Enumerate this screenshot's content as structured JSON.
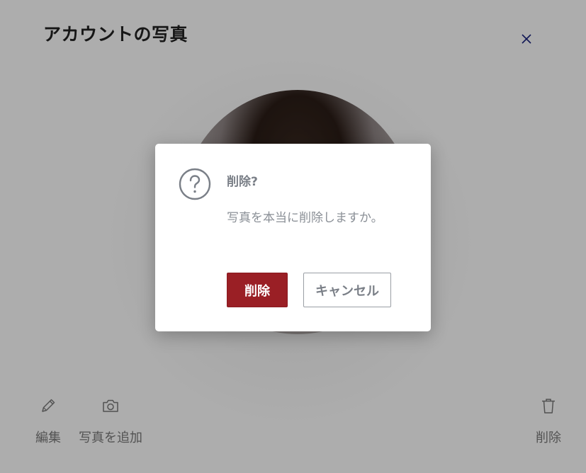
{
  "panel": {
    "title": "アカウントの写真",
    "close_icon": "close-icon",
    "actions": {
      "edit": {
        "label": "編集",
        "icon": "pencil-icon"
      },
      "add_photo": {
        "label": "写真を追加",
        "icon": "camera-icon"
      },
      "delete": {
        "label": "削除",
        "icon": "trash-icon"
      }
    }
  },
  "dialog": {
    "icon": "question-circle-icon",
    "title": "削除?",
    "message": "写真を本当に削除しますか。",
    "confirm_label": "削除",
    "cancel_label": "キャンセル"
  },
  "colors": {
    "confirm_button": "#9a1f25",
    "overlay": "rgba(0,0,0,0.32)",
    "close_icon": "#1a237e"
  }
}
